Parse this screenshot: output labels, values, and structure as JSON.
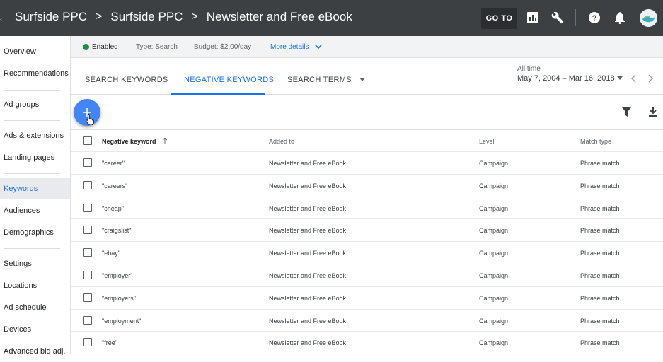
{
  "header": {
    "breadcrumbs": [
      "Surfside PPC",
      "Surfside PPC",
      "Newsletter and Free eBook"
    ],
    "separator": ">",
    "goto_label": "GO TO",
    "icons": [
      "reports-icon",
      "tools-wrench-icon",
      "help-icon",
      "notifications-bell-icon",
      "account-avatar"
    ]
  },
  "sidebar": {
    "items": [
      {
        "label": "Overview",
        "active": false
      },
      {
        "label": "Recommendations",
        "active": false
      },
      {
        "label": "Ad groups",
        "active": false
      },
      {
        "label": "Ads & extensions",
        "active": false
      },
      {
        "label": "Landing pages",
        "active": false
      },
      {
        "label": "Keywords",
        "active": true
      },
      {
        "label": "Audiences",
        "active": false
      },
      {
        "label": "Demographics",
        "active": false
      },
      {
        "label": "Settings",
        "active": false
      },
      {
        "label": "Locations",
        "active": false
      },
      {
        "label": "Ad schedule",
        "active": false
      },
      {
        "label": "Devices",
        "active": false
      },
      {
        "label": "Advanced bid adj.",
        "active": false
      }
    ]
  },
  "status": {
    "enabled": "Enabled",
    "type": "Type: Search",
    "budget": "Budget: $2.00/day",
    "more": "More details"
  },
  "tabs": {
    "items": [
      "SEARCH KEYWORDS",
      "NEGATIVE KEYWORDS",
      "SEARCH TERMS"
    ],
    "active": "NEGATIVE KEYWORDS"
  },
  "daterange": {
    "label": "All time",
    "value": "May 7, 2004 – Mar 16, 2018"
  },
  "table": {
    "columns": [
      "Negative keyword",
      "Added to",
      "Level",
      "Match type"
    ],
    "rows": [
      [
        "\"career\"",
        "Newsletter and Free eBook",
        "Campaign",
        "Phrase match"
      ],
      [
        "\"careers\"",
        "Newsletter and Free eBook",
        "Campaign",
        "Phrase match"
      ],
      [
        "\"cheap\"",
        "Newsletter and Free eBook",
        "Campaign",
        "Phrase match"
      ],
      [
        "\"craigslist\"",
        "Newsletter and Free eBook",
        "Campaign",
        "Phrase match"
      ],
      [
        "\"ebay\"",
        "Newsletter and Free eBook",
        "Campaign",
        "Phrase match"
      ],
      [
        "\"employer\"",
        "Newsletter and Free eBook",
        "Campaign",
        "Phrase match"
      ],
      [
        "\"employers\"",
        "Newsletter and Free eBook",
        "Campaign",
        "Phrase match"
      ],
      [
        "\"employment\"",
        "Newsletter and Free eBook",
        "Campaign",
        "Phrase match"
      ],
      [
        "\"free\"",
        "Newsletter and Free eBook",
        "Campaign",
        "Phrase match"
      ]
    ]
  },
  "colors": {
    "topbar": "#3c4043",
    "accent": "#1a73e8",
    "fab": "#4285f4",
    "enabled_dot": "#1e8e3e"
  }
}
